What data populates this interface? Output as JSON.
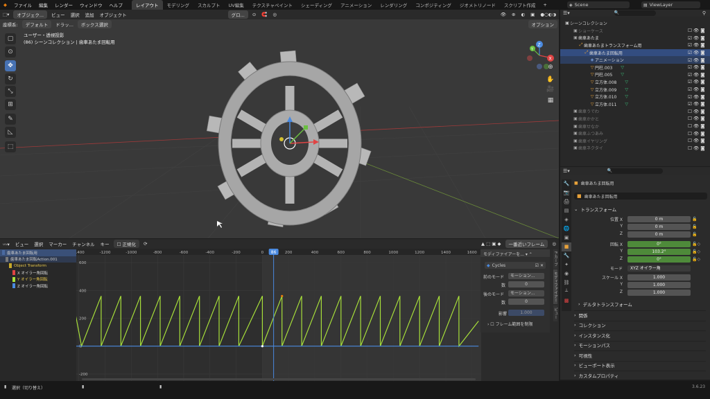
{
  "menu": [
    "ファイル",
    "編集",
    "レンダー",
    "ウィンドウ",
    "ヘルプ"
  ],
  "workspaces": [
    "レイアウト",
    "モデリング",
    "スカルプト",
    "UV編集",
    "テクスチャペイント",
    "シェーディング",
    "アニメーション",
    "レンダリング",
    "コンポジティング",
    "ジオメトリノード",
    "スクリプト作成"
  ],
  "scene": "Scene",
  "view_layer": "ViewLayer",
  "viewport": {
    "mode": "オブジェク...",
    "menus": [
      "ビュー",
      "選択",
      "追加",
      "オブジェクト"
    ],
    "transform_orientation": "グロ...",
    "sub": {
      "coord_label": "座標系:",
      "coord": "デフォルト",
      "drag_label": "ドラッ...",
      "select": "ボックス選択"
    },
    "options": "オプション",
    "overlay_title": "ユーザー・透視投影",
    "overlay_sub": "(86) シーンコレクション | 歯車あたま回転用",
    "axes": {
      "x": "X",
      "y": "Y",
      "z": "Z"
    }
  },
  "outliner": {
    "header": "シーンコレクション",
    "rows": [
      {
        "label": "ショーケース",
        "depth": 1,
        "dim": true
      },
      {
        "label": "歯車あたま",
        "depth": 1,
        "dim": false
      },
      {
        "label": "歯車あたまトランスフォーム用",
        "depth": 2,
        "dim": false
      },
      {
        "label": "歯車あたま回転用",
        "depth": 3,
        "dim": false,
        "selected": true
      },
      {
        "label": "アニメーション",
        "depth": 4,
        "dim": false,
        "selected": true
      },
      {
        "label": "円柱.003",
        "depth": 4,
        "dim": false
      },
      {
        "label": "円柱.005",
        "depth": 4,
        "dim": false
      },
      {
        "label": "立方体.008",
        "depth": 4,
        "dim": false
      },
      {
        "label": "立方体.009",
        "depth": 4,
        "dim": false
      },
      {
        "label": "立方体.010",
        "depth": 4,
        "dim": false
      },
      {
        "label": "立方体.011",
        "depth": 4,
        "dim": false
      },
      {
        "label": "歯車うでわ",
        "depth": 1,
        "dim": true
      },
      {
        "label": "歯車かかと",
        "depth": 1,
        "dim": true
      },
      {
        "label": "歯車せなか",
        "depth": 1,
        "dim": true
      },
      {
        "label": "歯車ふつあみ",
        "depth": 1,
        "dim": true
      },
      {
        "label": "歯車イヤリング",
        "depth": 1,
        "dim": true
      },
      {
        "label": "歯車ネクタイ",
        "depth": 1,
        "dim": true
      }
    ]
  },
  "properties": {
    "object_name": "歯車あたま回転用",
    "data_name": "歯車あたま回転用",
    "transform_title": "トランスフォーム",
    "location_label": "位置 X",
    "rotation_label": "回転 X",
    "scale_label": "スケール X",
    "y": "Y",
    "z": "Z",
    "location": [
      "0 m",
      "0 m",
      "0 m"
    ],
    "rotation": [
      "0°",
      "103.2°",
      "0°"
    ],
    "scale": [
      "1.000",
      "1.000",
      "1.000"
    ],
    "mode_label": "モード",
    "mode": "XYZ オイラー角",
    "sections": [
      "デルタトランスフォーム",
      "関係",
      "コレクション",
      "インスタンス化",
      "モーションパス",
      "可視性",
      "ビューポート表示",
      "カスタムプロパティ"
    ]
  },
  "graph": {
    "menus": [
      "ビュー",
      "選択",
      "マーカー",
      "チャンネル",
      "キー"
    ],
    "normalize": "正規化",
    "nearest_frame": "一番近いフレーム",
    "current_frame": "86",
    "frame_ticks": [
      "-1400",
      "-1200",
      "-1000",
      "-800",
      "-600",
      "-400",
      "-200",
      "0",
      "200",
      "400",
      "600",
      "800",
      "1000",
      "1200",
      "1400",
      "1600"
    ],
    "value_ticks": [
      "600",
      "400",
      "200",
      "0",
      "-200"
    ],
    "channels": [
      {
        "label": "歯車あたま回転用",
        "color": "#4a6aa0",
        "depth": 0
      },
      {
        "label": "歯車あたま回転Action.001",
        "color": "#7a7a7a",
        "depth": 1
      },
      {
        "label": "Object Transform",
        "color": "#c7a92b",
        "depth": 2
      },
      {
        "label": "X オイラー角回転",
        "color": "#e04444",
        "depth": 3
      },
      {
        "label": "Y オイラー角回転",
        "color": "#a8e03a",
        "depth": 3
      },
      {
        "label": "Z オイラー角回転",
        "color": "#4a8ae0",
        "depth": 3
      }
    ],
    "npanel": {
      "header": "モディファイアーを...",
      "modifier": "Cycles",
      "before_label": "前のモード",
      "before": "モーション...",
      "count_label": "数",
      "count_before": "0",
      "after_label": "後のモード",
      "after": "モーション...",
      "count_after": "0",
      "influence_label": "影響",
      "influence": "1.000",
      "restrict": "フレーム範囲を制限"
    },
    "side_tabs": [
      "F-カーブ",
      "モディファイアー",
      "ビュー"
    ]
  },
  "status": {
    "left": "選択（切り替え）",
    "version": "3.6.23"
  },
  "chart_data": {
    "type": "line",
    "title": "",
    "series": [
      {
        "name": "Y オイラー角回転",
        "color": "#a8e03a",
        "x": [
          -1450,
          -1380,
          -1230,
          -1230,
          -1080,
          -1080,
          -930,
          -930,
          -780,
          -780,
          -630,
          -630,
          -480,
          -480,
          -330,
          -330,
          -180,
          -180,
          0,
          0,
          150,
          150,
          300,
          300,
          450,
          450,
          600,
          600,
          750,
          750,
          900,
          900,
          1050,
          1050,
          1200,
          1200,
          1350,
          1350,
          1500,
          1500,
          1650
        ],
        "y": [
          350,
          0,
          360,
          0,
          360,
          0,
          360,
          0,
          360,
          0,
          360,
          0,
          360,
          0,
          360,
          0,
          360,
          0,
          360,
          0,
          360,
          0,
          360,
          0,
          360,
          0,
          360,
          0,
          360,
          0,
          360,
          0,
          360,
          0,
          360,
          0,
          360,
          0,
          360,
          0,
          180
        ]
      },
      {
        "name": "X オイラー角回転",
        "color": "#4a8ae0",
        "x": [
          -1450,
          1650
        ],
        "y": [
          0,
          0
        ]
      }
    ],
    "xlim": [
      -1500,
      1700
    ],
    "ylim": [
      -250,
      650
    ]
  }
}
